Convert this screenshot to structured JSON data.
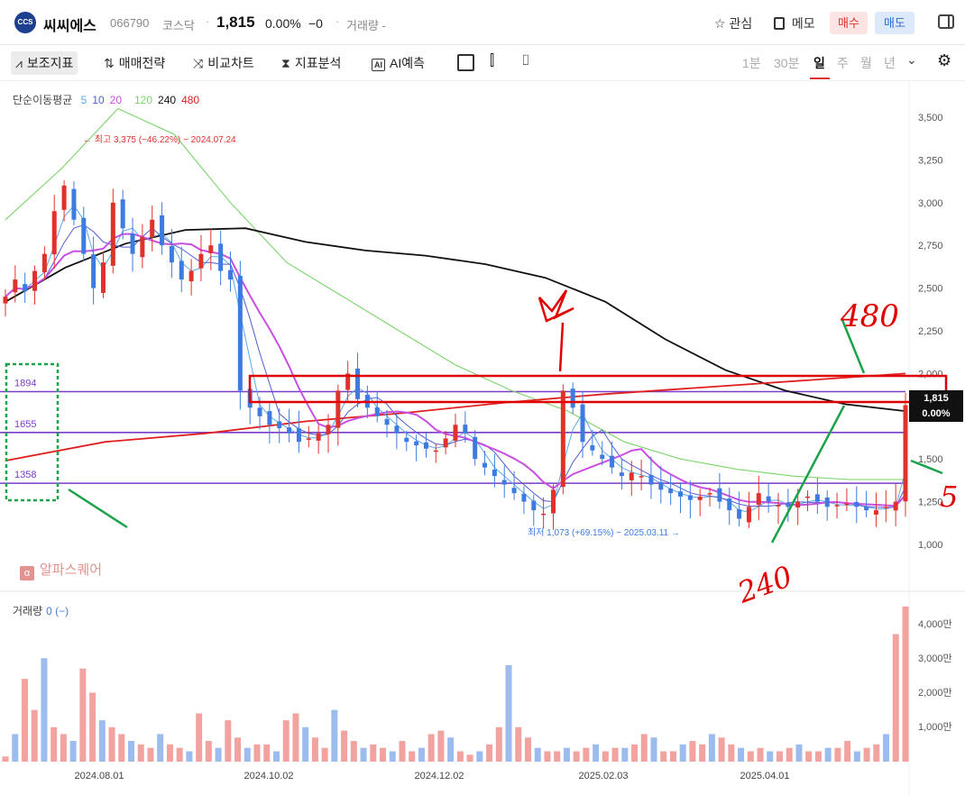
{
  "header": {
    "logo_text": "CCS",
    "name": "씨씨에스",
    "code": "066790",
    "market": "코스닥",
    "separator": "·",
    "price": "1,815",
    "change_pct": "0.00%",
    "change_abs": "−0",
    "volume_label": "거래량 -",
    "watch_label": "관심",
    "memo_label": "메모",
    "buy_label": "매수",
    "sell_label": "매도",
    "icons": {
      "watch": "star-icon",
      "memo": "memo-icon",
      "panel": "panel-layout-icon"
    }
  },
  "toolbar": {
    "indicators": "보조지표",
    "strategy": "매매전략",
    "compare": "비교차트",
    "analysis": "지표분석",
    "ai": "AI예측",
    "ai_badge": "AI",
    "periods": [
      "1분",
      "30분",
      "일",
      "주",
      "월",
      "년"
    ],
    "selected_period": "일",
    "caret": "⌄",
    "icons": [
      "indicator-icon",
      "strategy-icon",
      "compare-icon",
      "analysis-icon",
      "ai-icon",
      "square-icon",
      "candle-icon",
      "camera-icon",
      "settings-icon"
    ]
  },
  "legend": {
    "name": "단순이동평균",
    "ma_periods": [
      "5",
      "10",
      "20",
      "120",
      "240",
      "480"
    ],
    "ma_colors": [
      "#5aa9ea",
      "#4f5fd0",
      "#c84fe0",
      "#7bd46a",
      "#111111",
      "#e02020"
    ]
  },
  "volume_legend": {
    "label": "거래량",
    "value": "0 (−)"
  },
  "watermark": "알파스퀘어",
  "watermark_badge": "α",
  "tags": {
    "last_price": "1,815",
    "last_change": "0.00%"
  },
  "chart_data": [
    {
      "type": "candlestick",
      "y_axis": {
        "ticks": [
          "3,500",
          "3,250",
          "3,000",
          "2,750",
          "2,500",
          "2,250",
          "2,000",
          "1,750",
          "1,500",
          "1,250",
          "1,000"
        ],
        "range": [
          1000,
          3500
        ]
      },
      "x_axis": {
        "ticks": [
          "2024.08.01",
          "2024.10.02",
          "2024.12.02",
          "2025.02.03",
          "2025.04.01"
        ]
      },
      "annotations": {
        "high": "← 최고 3,375 (−46.22%) − 2024.07.24",
        "low": "최저 1,073 (+69.15%) − 2025.03.11 →"
      },
      "horizontal_lines": [
        {
          "label": "1894",
          "value": 1894
        },
        {
          "label": "1655",
          "value": 1655
        },
        {
          "label": "1358",
          "value": 1358
        }
      ],
      "handwritten_notes": [
        "480",
        "240",
        "5"
      ],
      "series_close": [
        2450,
        2550,
        2480,
        2600,
        2700,
        2950,
        3100,
        2900,
        2700,
        2500,
        2650,
        3000,
        2850,
        2700,
        2800,
        2900,
        2750,
        2650,
        2550,
        2600,
        2700,
        2750,
        2600,
        2550,
        1900,
        1800,
        1750,
        1700,
        1680,
        1650,
        1600,
        1620,
        1650,
        1700,
        1900,
        2000,
        1850,
        1800,
        1750,
        1700,
        1650,
        1600,
        1580,
        1560,
        1550,
        1620,
        1700,
        1650,
        1500,
        1450,
        1400,
        1350,
        1300,
        1250,
        1200,
        1180,
        1320,
        1900,
        1800,
        1600,
        1550,
        1500,
        1450,
        1400,
        1420,
        1400,
        1350,
        1320,
        1300,
        1280,
        1260,
        1280,
        1300,
        1250,
        1200,
        1150,
        1220,
        1300,
        1250,
        1230,
        1220,
        1250,
        1280,
        1250,
        1220,
        1230,
        1240,
        1220,
        1200,
        1200,
        1220,
        1250,
        1815
      ],
      "series": [
        {
          "name": "5",
          "color": "#5aa9ea"
        },
        {
          "name": "10",
          "color": "#4f5fd0"
        },
        {
          "name": "20",
          "color": "#c84fe0"
        },
        {
          "name": "120",
          "color": "#7bd46a",
          "values": [
            2900,
            3200,
            3550,
            3400,
            3000,
            2650,
            2450,
            2250,
            2050,
            1900,
            1780,
            1600,
            1500,
            1440,
            1400,
            1380,
            1380
          ]
        },
        {
          "name": "240",
          "color": "#111111",
          "values": [
            2420,
            2620,
            2760,
            2840,
            2850,
            2770,
            2720,
            2690,
            2640,
            2560,
            2420,
            2200,
            2020,
            1900,
            1820,
            1780
          ]
        },
        {
          "name": "480",
          "color": "#e02020",
          "values": [
            1490,
            1600,
            1650,
            1720,
            1770,
            1830,
            1880,
            1920,
            1960,
            2000
          ]
        }
      ]
    },
    {
      "type": "bar",
      "title": "거래량",
      "y_axis": {
        "ticks": [
          "4,000만",
          "3,000만",
          "2,000만",
          "1,000만"
        ]
      },
      "values_million": [
        1.5,
        8,
        24,
        15,
        30,
        10,
        8,
        6,
        27,
        20,
        12,
        10,
        8,
        6,
        5,
        4,
        8,
        5,
        4,
        3,
        14,
        6,
        4,
        12,
        7,
        4,
        5,
        5,
        3,
        12,
        14,
        10,
        7,
        4,
        15,
        9,
        6,
        4,
        5,
        4,
        3,
        6,
        3,
        4,
        8,
        9,
        7,
        3,
        2,
        3,
        5,
        10,
        28,
        10,
        7,
        4,
        3,
        3,
        4,
        3,
        4,
        5,
        3,
        4,
        4,
        5,
        8,
        7,
        3,
        3,
        5,
        6,
        5,
        8,
        7,
        5,
        4,
        3,
        4,
        3,
        3,
        4,
        5,
        3,
        3,
        4,
        4,
        6,
        3,
        4,
        5,
        8,
        37,
        45
      ]
    }
  ]
}
